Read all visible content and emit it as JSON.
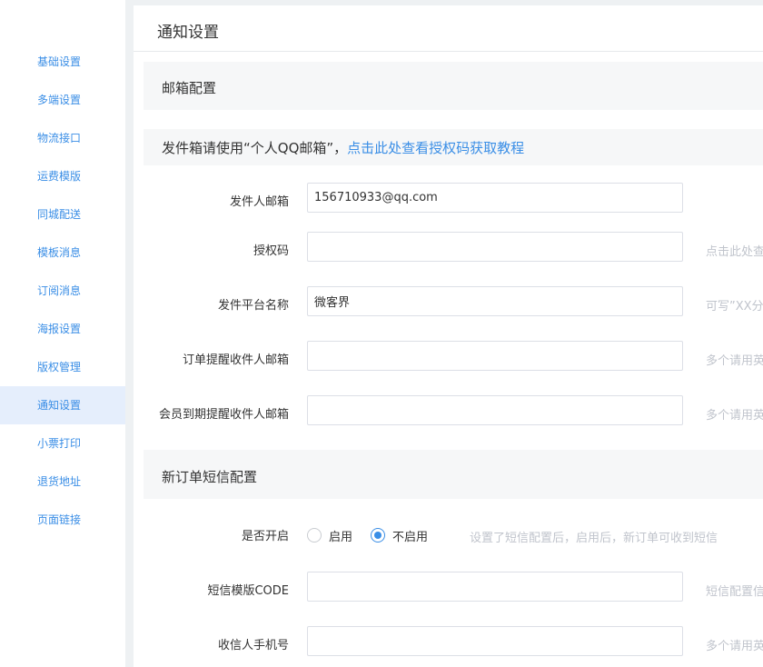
{
  "sidebar": {
    "items": [
      {
        "label": "基础设置"
      },
      {
        "label": "多端设置"
      },
      {
        "label": "物流接口"
      },
      {
        "label": "运费模版"
      },
      {
        "label": "同城配送"
      },
      {
        "label": "模板消息"
      },
      {
        "label": "订阅消息"
      },
      {
        "label": "海报设置"
      },
      {
        "label": "版权管理"
      },
      {
        "label": "通知设置"
      },
      {
        "label": "小票打印"
      },
      {
        "label": "退货地址"
      },
      {
        "label": "页面链接"
      }
    ],
    "active": "通知设置"
  },
  "page": {
    "title": "通知设置"
  },
  "email_section": {
    "title": "邮箱配置",
    "notice_text": "发件箱请使用“个人QQ邮箱”，",
    "notice_link": "点击此处查看授权码获取教程",
    "fields": {
      "sender_email": {
        "label": "发件人邮箱",
        "value": "156710933@qq.com",
        "hint": ""
      },
      "auth_code": {
        "label": "授权码",
        "value": "",
        "hint": "点击此处查"
      },
      "platform_name": {
        "label": "发件平台名称",
        "value": "微客界",
        "hint": "可写”XX分"
      },
      "order_recipient": {
        "label": "订单提醒收件人邮箱",
        "value": "",
        "hint": "多个请用英"
      },
      "member_recipient": {
        "label": "会员到期提醒收件人邮箱",
        "value": "",
        "hint": "多个请用英"
      }
    }
  },
  "sms_section": {
    "title": "新订单短信配置",
    "enable": {
      "label": "是否开启",
      "options": [
        "启用",
        "不启用"
      ],
      "selected": "不启用",
      "hint": "设置了短信配置后，启用后，新订单可收到短信"
    },
    "template_code": {
      "label": "短信模版CODE",
      "value": "",
      "hint": "短信配置信"
    },
    "phone": {
      "label": "收信人手机号",
      "value": "",
      "hint": "多个请用英"
    }
  },
  "colors": {
    "accent": "#3a8ee6",
    "section_bg": "#f6f7f8",
    "active_bg": "#e5eefc"
  }
}
